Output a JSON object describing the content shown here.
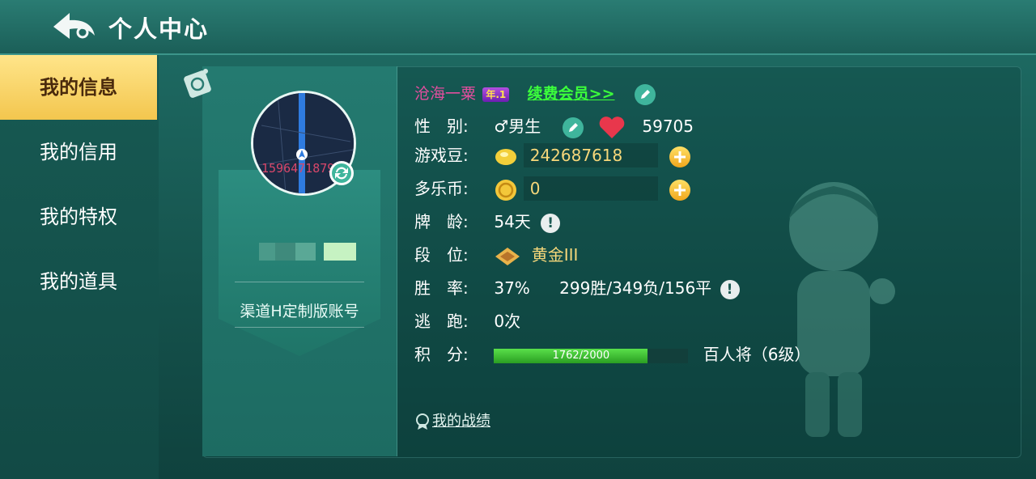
{
  "header": {
    "title": "个人中心",
    "back_icon": "back-arrow-icon"
  },
  "sidebar": {
    "items": [
      {
        "label": "我的信息",
        "active": true
      },
      {
        "label": "我的信用",
        "active": false
      },
      {
        "label": "我的特权",
        "active": false
      },
      {
        "label": "我的道具",
        "active": false
      }
    ]
  },
  "profile": {
    "avatar_text": "1596471879",
    "account_type": "渠道H定制版账号"
  },
  "info": {
    "nickname": "沧海一粟",
    "year_badge": "年.1",
    "vip_link": "续费会员>>",
    "gender_label": "性　别:",
    "gender_value": "♂男生",
    "charm_value": "59705",
    "beans_label": "游戏豆:",
    "beans_value": "242687618",
    "coins_label": "多乐币:",
    "coins_value": "0",
    "age_label": "牌　龄:",
    "age_value": "54天",
    "rank_label": "段　位:",
    "rank_value": "黄金III",
    "winrate_label": "胜　率:",
    "winrate_value": "37%",
    "record_value": "299胜/349负/156平",
    "escape_label": "逃　跑:",
    "escape_value": "0次",
    "score_label": "积　分:",
    "score_text": "1762/2000",
    "score_progress": 0.881,
    "level_title": "百人将（6级）",
    "info_icon_text": "!"
  },
  "record_link": "我的战绩",
  "colors": {
    "accent_green": "#3bff3b",
    "nickname_pink": "#e24e9e",
    "active_tab": "#f3c64e"
  }
}
